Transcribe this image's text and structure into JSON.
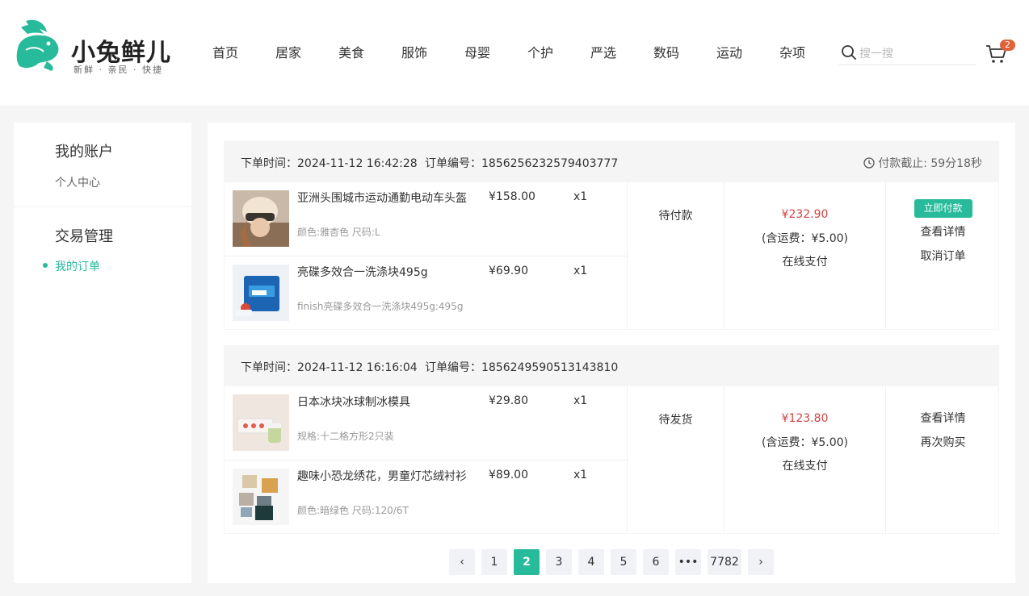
{
  "brand": {
    "name": "小兔鲜儿",
    "tagline": "新鲜 · 亲民 · 快捷",
    "color": "#27ba9b"
  },
  "nav": [
    "首页",
    "居家",
    "美食",
    "服饰",
    "母婴",
    "个护",
    "严选",
    "数码",
    "运动",
    "杂项"
  ],
  "search": {
    "placeholder": "搜一搜"
  },
  "cart": {
    "count": "2"
  },
  "sidebar": {
    "account_title": "我的账户",
    "account_items": [
      "个人中心"
    ],
    "trade_title": "交易管理",
    "trade_items": [
      "我的订单"
    ]
  },
  "orders": [
    {
      "time_label": "下单时间：",
      "time": "2024-11-12 16:42:28",
      "no_label": "订单编号：",
      "no": "1856256232579403777",
      "deadline": "付款截止: 59分18秒",
      "status": "待付款",
      "total": "¥232.90",
      "freight": "(含运费：¥5.00)",
      "pay_type": "在线支付",
      "primary_action": "立即付款",
      "actions": [
        "查看详情",
        "取消订单"
      ],
      "goods": [
        {
          "name": "亚洲头围城市运动通勤电动车头盔",
          "spec": "颜色:雅杏色 尺码:L",
          "price": "¥158.00",
          "qty": "x1",
          "img": "helmet-photo"
        },
        {
          "name": "亮碟多效合一洗涤块495g",
          "spec": "finish亮碟多效合一洗涤块495g:495g",
          "price": "¥69.90",
          "qty": "x1",
          "img": "detergent-photo"
        }
      ]
    },
    {
      "time_label": "下单时间：",
      "time": "2024-11-12 16:16:04",
      "no_label": "订单编号：",
      "no": "1856249590513143810",
      "deadline": "",
      "status": "待发货",
      "total": "¥123.80",
      "freight": "(含运费：¥5.00)",
      "pay_type": "在线支付",
      "primary_action": "",
      "actions": [
        "查看详情",
        "再次购买"
      ],
      "goods": [
        {
          "name": "日本冰块冰球制冰模具",
          "spec": "规格:十二格方形2只装",
          "price": "¥29.80",
          "qty": "x1",
          "img": "ice-mold-photo"
        },
        {
          "name": "趣味小恐龙绣花，男童灯芯绒衬衫",
          "spec": "颜色:暗绿色 尺码:120/6T",
          "price": "¥89.00",
          "qty": "x1",
          "img": "shirts-photo"
        }
      ]
    }
  ],
  "pagination": {
    "prev": "‹",
    "pages": [
      "1",
      "2",
      "3",
      "4",
      "5",
      "6"
    ],
    "ellipsis": "•••",
    "last": "7782",
    "next": "›",
    "current": "2"
  }
}
